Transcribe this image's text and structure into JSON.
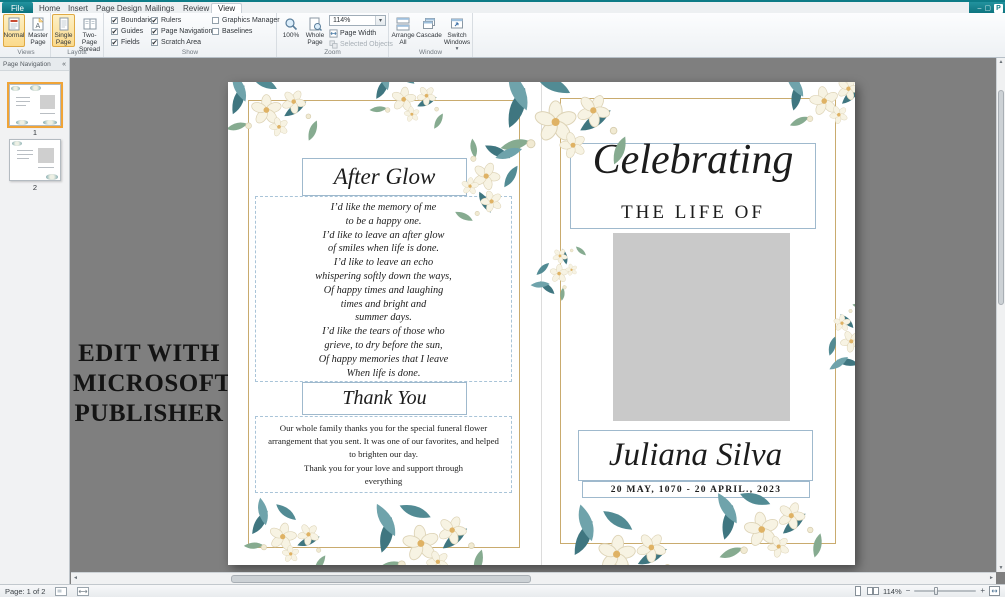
{
  "titlebar": {
    "publisher_badge": "P",
    "minimize_glyph": "–",
    "maximize_glyph": "▢"
  },
  "ribbon": {
    "tabs": [
      {
        "label": "File"
      },
      {
        "label": "Home"
      },
      {
        "label": "Insert"
      },
      {
        "label": "Page Design"
      },
      {
        "label": "Mailings"
      },
      {
        "label": "Review"
      },
      {
        "label": "View",
        "active": true
      }
    ],
    "groups": {
      "views": {
        "label": "Views",
        "normal": "Normal",
        "normal_selected": true,
        "master_page": "Master Page"
      },
      "layout": {
        "label": "Layout",
        "single_page": "Single Page",
        "single_page_selected": true,
        "two_page_spread": "Two-Page Spread"
      },
      "show": {
        "label": "Show",
        "items": [
          {
            "label": "Boundaries",
            "checked": true
          },
          {
            "label": "Guides",
            "checked": true
          },
          {
            "label": "Fields",
            "checked": true
          },
          {
            "label": "Rulers",
            "checked": true
          },
          {
            "label": "Page Navigation",
            "checked": true
          },
          {
            "label": "Scratch Area",
            "checked": true
          },
          {
            "label": "Graphics Manager",
            "checked": false
          },
          {
            "label": "Baselines",
            "checked": false
          }
        ]
      },
      "zoom": {
        "label": "Zoom",
        "zoom_100": "100%",
        "whole_page": "Whole Page",
        "page_width": "Page Width",
        "selected_objects": "Selected Objects",
        "zoom_value": "114%"
      },
      "window": {
        "label": "Window",
        "arrange_all": "Arrange All",
        "cascade": "Cascade",
        "switch_windows": "Switch Windows"
      }
    }
  },
  "page_navigation": {
    "title": "Page Navigation",
    "collapse_glyph": "«",
    "pages": [
      {
        "number": "1",
        "selected": true
      },
      {
        "number": "2",
        "selected": false
      }
    ]
  },
  "scratch_overlay": {
    "line1": "EDIT WITH",
    "line2": "MICROSOFT",
    "line3": "PUBLISHER"
  },
  "document": {
    "left_page": {
      "after_glow_title": "After Glow",
      "poem": [
        "I’d like the memory of me",
        "to be a happy one.",
        "I’d like to leave an after glow",
        "of smiles when life is done.",
        "I’d like to leave an echo",
        "whispering softly down the ways,",
        "Of happy times and laughing",
        "times and bright and",
        "summer days.",
        "I’d like the tears of those who",
        "grieve, to dry before the sun,",
        "Of happy memories that I leave",
        "When life is done."
      ],
      "thank_you_title": "Thank You",
      "thanks": [
        "Our whole family thanks you for the special funeral flower",
        "arrangement that you sent. It was one of our favorites, and helped",
        "to brighten our day.",
        "Thank you for your love and support through",
        "everything"
      ]
    },
    "right_page": {
      "celebrating": "Celebrating",
      "the_life_of": "THE LIFE OF",
      "name": "Juliana Silva",
      "dates": "20 MAY, 1070 - 20 APRIL., 2023"
    }
  },
  "status_bar": {
    "page_info": "Page: 1 of 2",
    "zoom_value": "114%"
  },
  "icons": {
    "chevron_down": "▾",
    "scroll_up": "▲",
    "scroll_down": "▼",
    "scroll_left": "◄",
    "scroll_right": "►",
    "zoom_out": "−",
    "zoom_in": "+"
  },
  "colors": {
    "publisher_teal": "#0d7c87",
    "selection_highlight": "#fbda8c",
    "canvas_gray": "#7f7f7f",
    "frame_gold": "#c9ab6e",
    "floral_teal": "#5d98a0"
  }
}
